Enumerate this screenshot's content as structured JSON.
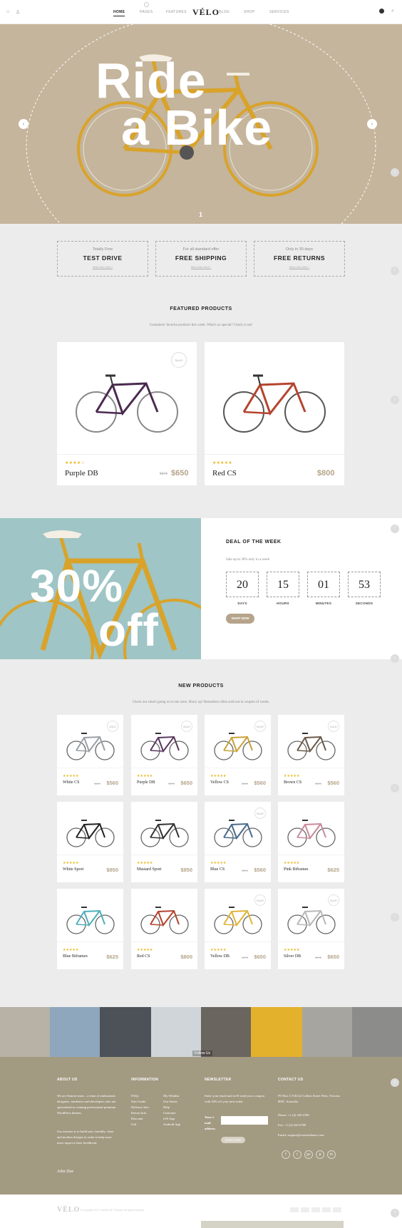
{
  "header": {
    "logo": "VÉLO",
    "nav": [
      "HOME",
      "PAGES",
      "FEATURES",
      "BLOG",
      "SHOP",
      "SERVICES"
    ]
  },
  "hero": {
    "line1": "Ride",
    "line2": "a Bike",
    "slide_no": "1"
  },
  "features": [
    {
      "sub": "Totally Free",
      "title": "TEST DRIVE",
      "link": "More info here ›"
    },
    {
      "sub": "For all standard offer",
      "title": "FREE SHIPPING",
      "link": "More info here ›"
    },
    {
      "sub": "Only in 30 days",
      "title": "FREE RETURNS",
      "link": "More info here ›"
    }
  ],
  "featured": {
    "title": "FEATURED PRODUCTS",
    "subtitle": "Customers' favorite products this week. What's so special? Check it out!",
    "items": [
      {
        "name": "Purple DB",
        "price": "$650",
        "old": "$875",
        "badge": "SALE!",
        "stars": "★★★★☆"
      },
      {
        "name": "Red CS",
        "price": "$800",
        "old": "",
        "badge": "",
        "stars": "★★★★★"
      }
    ]
  },
  "deal": {
    "img_line1": "30%",
    "img_line2": "off",
    "title": "DEAL OF THE WEEK",
    "subtitle": "Sale up to 30% only in a week",
    "countdown": [
      {
        "v": "20",
        "l": "DAYS"
      },
      {
        "v": "15",
        "l": "HOURS"
      },
      {
        "v": "01",
        "l": "MINUTES"
      },
      {
        "v": "53",
        "l": "SECONDS"
      }
    ],
    "button": "SHOP NOW"
  },
  "newprod": {
    "title": "NEW PRODUCTS",
    "subtitle": "Check out what's going on in the store. Hurry up! Bestsellers often sold out in couples of weeks.",
    "items": [
      {
        "name": "White CS",
        "price": "$560",
        "old": "$620",
        "badge": "SOLD",
        "color": "#9aa0a6"
      },
      {
        "name": "Purple DB",
        "price": "$650",
        "old": "$875",
        "badge": "SALE!",
        "color": "#5a3a5e"
      },
      {
        "name": "Yellow CS",
        "price": "$560",
        "old": "$620",
        "badge": "SALE!",
        "color": "#c9a23a"
      },
      {
        "name": "Brown CS",
        "price": "$560",
        "old": "$620",
        "badge": "SALE!",
        "color": "#6b5a4a"
      },
      {
        "name": "White Sport",
        "price": "$850",
        "old": "",
        "badge": "",
        "color": "#222"
      },
      {
        "name": "Mustard Sport",
        "price": "$850",
        "old": "",
        "badge": "",
        "color": "#333"
      },
      {
        "name": "Blue CS",
        "price": "$560",
        "old": "$620",
        "badge": "SALE!",
        "color": "#4a6a8a"
      },
      {
        "name": "Pink Biframes",
        "price": "$625",
        "old": "",
        "badge": "",
        "color": "#c98a9a"
      },
      {
        "name": "Blue Biframes",
        "price": "$625",
        "old": "",
        "badge": "",
        "color": "#4fb0b8"
      },
      {
        "name": "Red CS",
        "price": "$800",
        "old": "",
        "badge": "",
        "color": "#b5442e"
      },
      {
        "name": "Yellow DB",
        "price": "$650",
        "old": "$875",
        "badge": "SALE!",
        "color": "#e0b53a"
      },
      {
        "name": "Silver DB",
        "price": "$650",
        "old": "$875",
        "badge": "SALE!",
        "color": "#b8b8b8"
      }
    ]
  },
  "instagram": {
    "follow": "Follow Us"
  },
  "footer": {
    "about_title": "ABOUT US",
    "about_p1": "We are Sunrise team – a team of enthusiastic designers, marketers and developers who are specialized in creating professional premium WordPress themes.",
    "about_p2": "Our mission is to build user–friendly, clean and modern designs in order to help more users improve their livelihood.",
    "signature": "John Doe",
    "info_title": "INFORMATION",
    "info_col1": [
      "FAQs",
      "Size Guide",
      "Delivery Info",
      "Return Info",
      "Discount",
      "Gift"
    ],
    "info_col2": [
      "My Wishlist",
      "Our Stores",
      "Help",
      "Customer",
      "iOS App",
      "Android App"
    ],
    "news_title": "NEWSLETTER",
    "news_text": "Enter your email and we'll send you a coupon with 10% off your next order.",
    "news_label": "Your e-mail address",
    "news_button": "SUBSCRIBE",
    "contact_title": "CONTACT US",
    "contact_addr": "PO Box CT16122 Collins Street West, Victoria 8007, Australia",
    "contact_phone": "Phone: +1 (2) 345 6789",
    "contact_fax": "Fax: +1 (2) 345 6789",
    "contact_email": "Email: support@sunrisetheme.com",
    "social": [
      "f",
      "t",
      "g+",
      "p",
      "in"
    ]
  },
  "bottom": {
    "logo": "VÉLO",
    "copyright": "© Copyright 2017 Sunrise WP Themes. All rights reserved."
  }
}
